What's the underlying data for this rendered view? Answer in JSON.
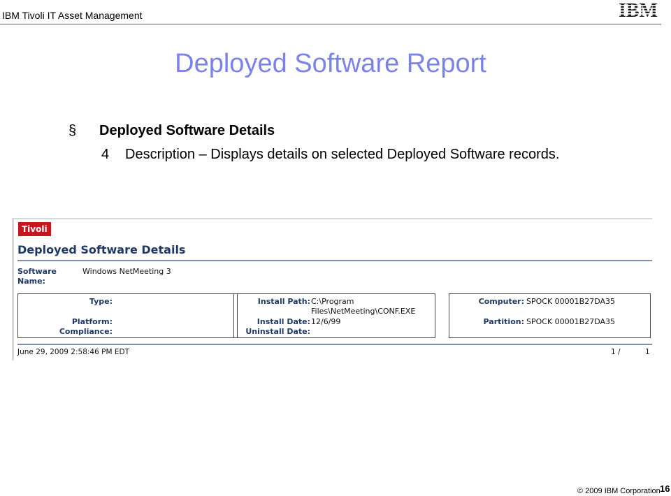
{
  "header": {
    "title": "IBM Tivoli IT Asset Management",
    "logo_text": "IBM"
  },
  "slide": {
    "title": "Deployed Software Report",
    "bullet1": {
      "symbol": "§",
      "text": "Deployed Software Details"
    },
    "bullet2": {
      "symbol": "4",
      "text": "Description – Displays details on selected Deployed Software records."
    }
  },
  "screenshot": {
    "brand": "Tivoli",
    "report_title": "Deployed Software Details",
    "software_name_label": "Software Name:",
    "software_name_value": "Windows NetMeeting 3",
    "box1": {
      "type_label": "Type:",
      "platform_label": "Platform:",
      "compliance_label": "Compliance:"
    },
    "box2": {
      "install_path_label": "Install Path:",
      "install_path_line1": "C:\\Program",
      "install_path_line2": "Files\\NetMeeting\\CONF.EXE",
      "install_date_label": "Install Date:",
      "install_date_value": "12/6/99",
      "uninstall_date_label": "Uninstall Date:"
    },
    "box3": {
      "computer_label": "Computer:",
      "computer_value": "SPOCK 00001B27DA35",
      "partition_label": "Partition:",
      "partition_value": "SPOCK 00001B27DA35"
    },
    "footer": {
      "timestamp": "June 29, 2009 2:58:46 PM EDT",
      "page": "1  /",
      "total": "1"
    }
  },
  "footer": {
    "copyright": "© 2009 IBM Corporation",
    "page_number": "16"
  },
  "colors": {
    "title_blue": "#7b82e8",
    "report_navy": "#1f3864",
    "tivoli_red": "#c8161d"
  }
}
